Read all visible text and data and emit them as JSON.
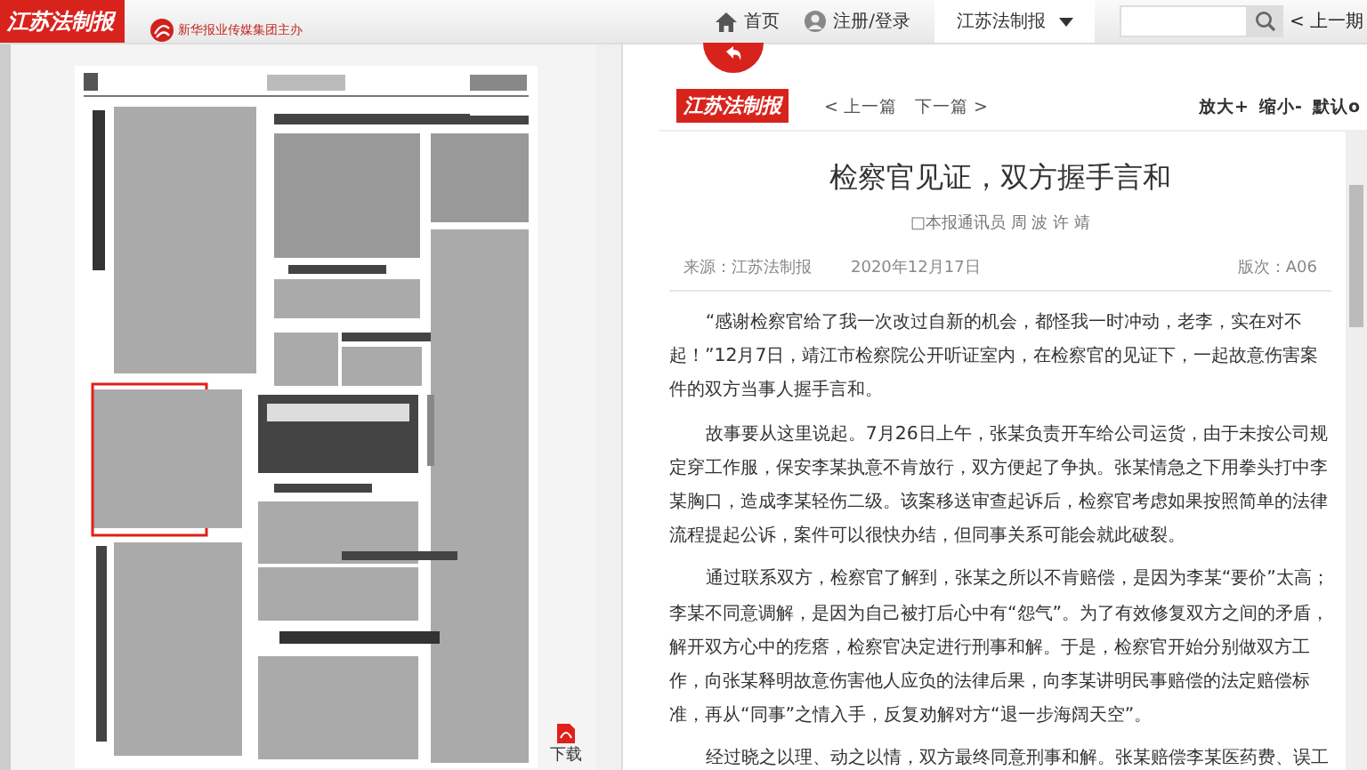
{
  "header": {
    "logo": "江苏法制报",
    "sponsor": "新华报业传媒集团主办",
    "nav": [
      {
        "label": "首页",
        "kind": "home"
      },
      {
        "label": "注册/登录",
        "kind": "user"
      }
    ],
    "paper_select": "江苏法制报",
    "previous_issue": "< 上一期"
  },
  "page_view": {
    "download": "下载"
  },
  "article": {
    "logo": "江苏法制报",
    "prev": "< 上一篇",
    "next": "下一篇 >",
    "zoom": [
      "放大+",
      "缩小-",
      "默认o"
    ],
    "title": "检察官见证，双方握手言和",
    "byline": "□本报通讯员 周 波 许 靖",
    "source": "来源：江苏法制报",
    "date": "2020年12月17日",
    "edition": "版次：A06",
    "paragraphs": [
      "“感谢检察官给了我一次改过自新的机会，都怪我一时冲动，老李，实在对不起！”12月7日，靖江市检察院公开听证室内，在检察官的见证下，一起故意伤害案件的双方当事人握手言和。",
      "故事要从这里说起。7月26日上午，张某负责开车给公司运货，由于未按公司规定穿工作服，保安李某执意不肯放行，双方便起了争执。张某情急之下用拳头打中李某胸口，造成李某轻伤二级。该案移送审查起诉后，检察官考虑如果按照简单的法律流程提起公诉，案件可以很快办结，但同事关系可能会就此破裂。",
      "通过联系双方，检察官了解到，张某之所以不肯赔偿，是因为李某“要价”太高；李某不同意调解，是因为自己被打后心中有“怨气”。为了有效修复双方之间的矛盾，解开双方心中的疙瘩，检察官决定进行刑事和解。于是，检察官开始分别做双方工作，向张某释明故意伤害他人应负的法律后果，向李某讲明民事赔偿的法定赔偿标准，再从“同事”之情入手，反复劝解对方“退一步海阔天空”。",
      "经过晓之以理、动之以情，双方最终同意刑事和解。张某赔偿李某医药费、误工"
    ]
  }
}
